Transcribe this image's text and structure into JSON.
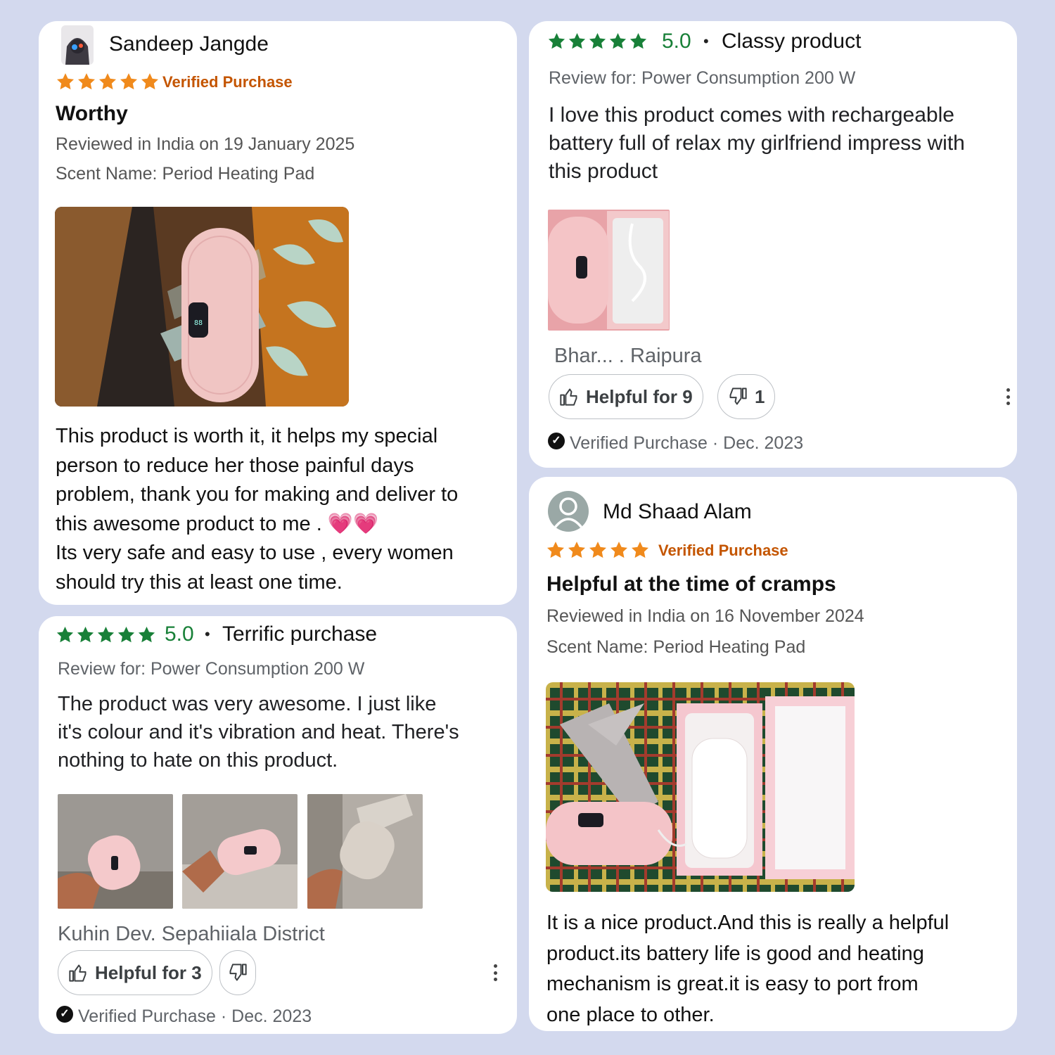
{
  "colors": {
    "background": "#d3d9ee",
    "amazon_star": "#f08a1c",
    "verified_orange": "#c45500",
    "google_star": "#188038"
  },
  "review1": {
    "author": "Sandeep Jangde",
    "rating": 5,
    "verified": "Verified Purchase",
    "title": "Worthy",
    "date_line": "Reviewed in India on 19 January 2025",
    "variant": "Scent Name: Period Heating Pad",
    "body_lines": [
      "This product is worth it, it helps my special",
      "person to reduce her those painful days",
      "problem, thank you for making and deliver to",
      "this awesome product to me . 💗💗",
      "Its very safe and easy to use , every women",
      "should try this at least one time."
    ]
  },
  "review2": {
    "rating": 5,
    "score": "5.0",
    "headline": "Classy product",
    "review_for": "Review for: Power Consumption 200 W",
    "body_lines": [
      "I love this product comes with rechargeable",
      "battery full of relax my girlfriend impress with",
      "this product"
    ],
    "author": "Bhar... . Raipura",
    "helpful_label": "Helpful for 9",
    "unhelpful_count": "1",
    "footer": "Verified Purchase · Dec. 2023"
  },
  "review3": {
    "rating": 5,
    "score": "5.0",
    "headline": "Terrific purchase",
    "review_for": "Review for: Power Consumption 200 W",
    "body_lines": [
      "The product was very awesome. I just like",
      "it's colour and it's vibration and heat. There's",
      "nothing to hate on this product."
    ],
    "author": "Kuhin Dev. Sepahiiala District",
    "helpful_label": "Helpful for 3",
    "footer": "Verified Purchase · Dec. 2023"
  },
  "review4": {
    "author": "Md Shaad Alam",
    "rating": 5,
    "verified": "Verified Purchase",
    "title": "Helpful at the time of cramps",
    "date_line": "Reviewed in India on 16 November 2024",
    "variant": "Scent Name: Period Heating Pad",
    "body_lines": [
      "It is a nice product.And this is really a helpful",
      "product.its battery life is good and heating",
      "mechanism is great.it is easy to port from",
      "one place to other."
    ]
  }
}
